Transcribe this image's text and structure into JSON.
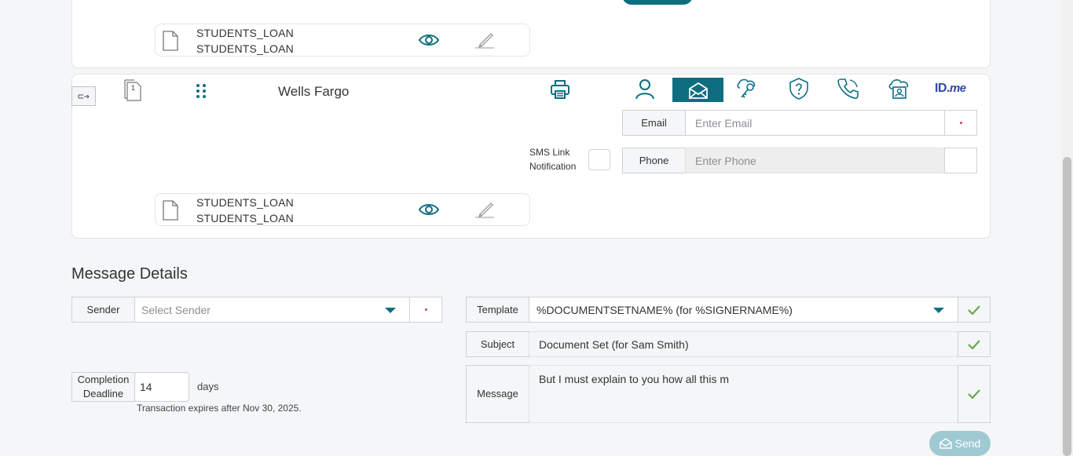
{
  "card1": {
    "doc": {
      "line1": "STUDENTS_LOAN",
      "line2": "STUDENTS_LOAN"
    }
  },
  "card2": {
    "page_number": "1",
    "signer_name": "Wells Fargo",
    "email_label": "Email",
    "email_placeholder": "Enter Email",
    "sms_label_line1": "SMS Link",
    "sms_label_line2": "Notification",
    "phone_label": "Phone",
    "phone_placeholder": "Enter Phone",
    "idme_label_id": "ID.",
    "idme_label_me": "me",
    "doc": {
      "line1": "STUDENTS_LOAN",
      "line2": "STUDENTS_LOAN"
    }
  },
  "message_details": {
    "heading": "Message Details",
    "sender_label": "Sender",
    "sender_placeholder": "Select Sender",
    "completion_label_line1": "Completion",
    "completion_label_line2": "Deadline",
    "completion_value": "14",
    "days_label": "days",
    "expires_text": "Transaction expires after Nov 30, 2025.",
    "template_label": "Template",
    "template_value": "%DOCUMENTSETNAME% (for %SIGNERNAME%)",
    "subject_label": "Subject",
    "subject_value": "Document Set (for Sam Smith)",
    "message_label": "Message",
    "message_value": "But I must explain to you how all this m",
    "send_label": "Send"
  },
  "colors": {
    "accent": "#0e6e80",
    "check": "#6aa84f",
    "required": "#d0455d",
    "send_button": "#9fc9d3"
  }
}
